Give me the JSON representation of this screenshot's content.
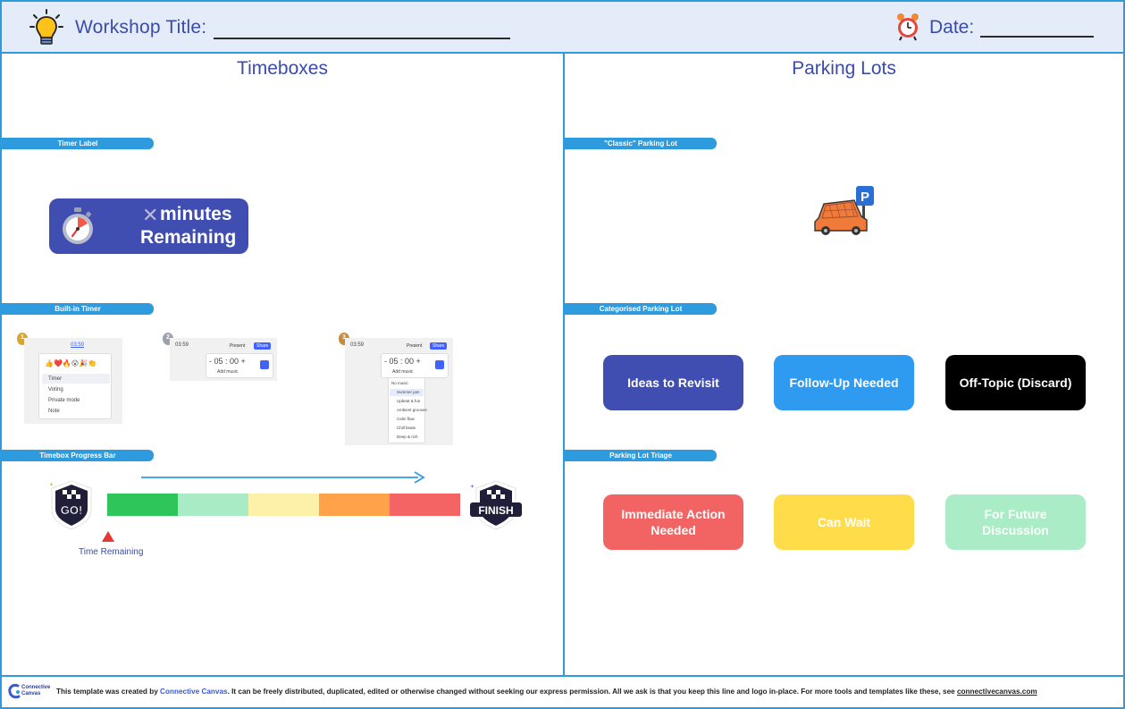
{
  "header": {
    "workshop_title_label": "Workshop Title:",
    "date_label": "Date:"
  },
  "timeboxes": {
    "title": "Timeboxes",
    "sections": {
      "timer_label": "Timer Label",
      "built_in_timer": "Built-in Timer",
      "progress_bar": "Timebox Progress Bar"
    },
    "timer_card": {
      "x_mark": "✕",
      "line1": "minutes",
      "line2": "Remaining"
    },
    "steps": [
      {
        "number": "1",
        "timer_text": "03:59",
        "items": [
          "Timer",
          "Voting",
          "Private mode",
          "Note"
        ]
      },
      {
        "number": "2",
        "timer_text": "03:59",
        "time": "- 05 : 00 +",
        "add": "Add music",
        "share": "Share",
        "present": "Present"
      },
      {
        "number": "3",
        "timer_text": "03:59",
        "time": "- 05 : 00 +",
        "add": "Add music",
        "share": "Share",
        "present": "Present",
        "menu": [
          "No music",
          "Summer jam",
          "Upbeat & fun",
          "Ambient grooves",
          "Calm flow",
          "Chill beats",
          "Deep & rich"
        ]
      }
    ],
    "progress": {
      "start_badge": "GO!",
      "finish_badge": "FINISH",
      "marker_label": "Time Remaining",
      "segment_colors": [
        "#2ec55a",
        "#a8ebc5",
        "#fdf1a9",
        "#ffa24a",
        "#f46464"
      ]
    }
  },
  "parking_lots": {
    "title": "Parking Lots",
    "sections": {
      "classic": "\"Classic\" Parking Lot",
      "categorised": "Categorised Parking Lot",
      "triage": "Parking Lot Triage"
    },
    "parking_sign": "P",
    "categories": [
      {
        "label": "Ideas to Revisit",
        "color": "#3f4eb0",
        "text_color": "#ffffff"
      },
      {
        "label": "Follow-Up Needed",
        "color": "#2e9bf0",
        "text_color": "#ffffff"
      },
      {
        "label": "Off-Topic (Discard)",
        "color": "#000000",
        "text_color": "#ffffff"
      }
    ],
    "triage": [
      {
        "label": "Immediate Action Needed",
        "color": "#f26464",
        "text_color": "#ffffff"
      },
      {
        "label": "Can Wait",
        "color": "#ffdd4a",
        "text_color": "#ffffff"
      },
      {
        "label": "For Future Discussion",
        "color": "#a9ecc6",
        "text_color": "#ffffff"
      }
    ]
  },
  "footer": {
    "logo_line1": "Connective",
    "logo_line2": "Canvas",
    "note_before": "This template was created by ",
    "brand": "Connective Canvas",
    "note_after": ". It can be freely distributed, duplicated, edited or otherwise changed without seeking our express permission. All we ask is that you keep this line and logo in-place. For more tools and templates like these, see ",
    "link": "connectivecanvas.com"
  }
}
